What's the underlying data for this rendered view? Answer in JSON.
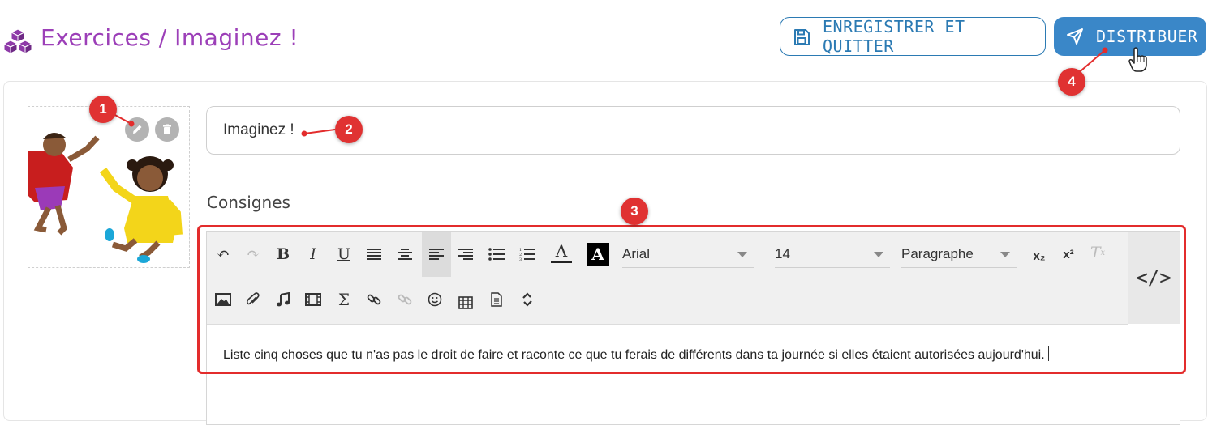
{
  "header": {
    "breadcrumb": "Exercices / Imaginez !",
    "save_button": "ENREGISTRER ET QUITTER",
    "distribute_button": "DISTRIBUER"
  },
  "form": {
    "title_value": "Imaginez !",
    "instructions_label": "Consignes"
  },
  "editor": {
    "font_family": "Arial",
    "font_size": "14",
    "block_format": "Paragraphe",
    "subscript": "x₂",
    "superscript": "x²",
    "code_view": "</>",
    "content": "Liste cinq choses que tu n'as pas le droit de faire et raconte ce que tu ferais de différents dans ta journée si elles étaient autorisées aujourd'hui."
  },
  "annotations": [
    "1",
    "2",
    "3",
    "4"
  ],
  "colors": {
    "title_purple": "#9c3fb8",
    "primary_blue": "#3a87c8",
    "annotation_red": "#e32c2c"
  }
}
